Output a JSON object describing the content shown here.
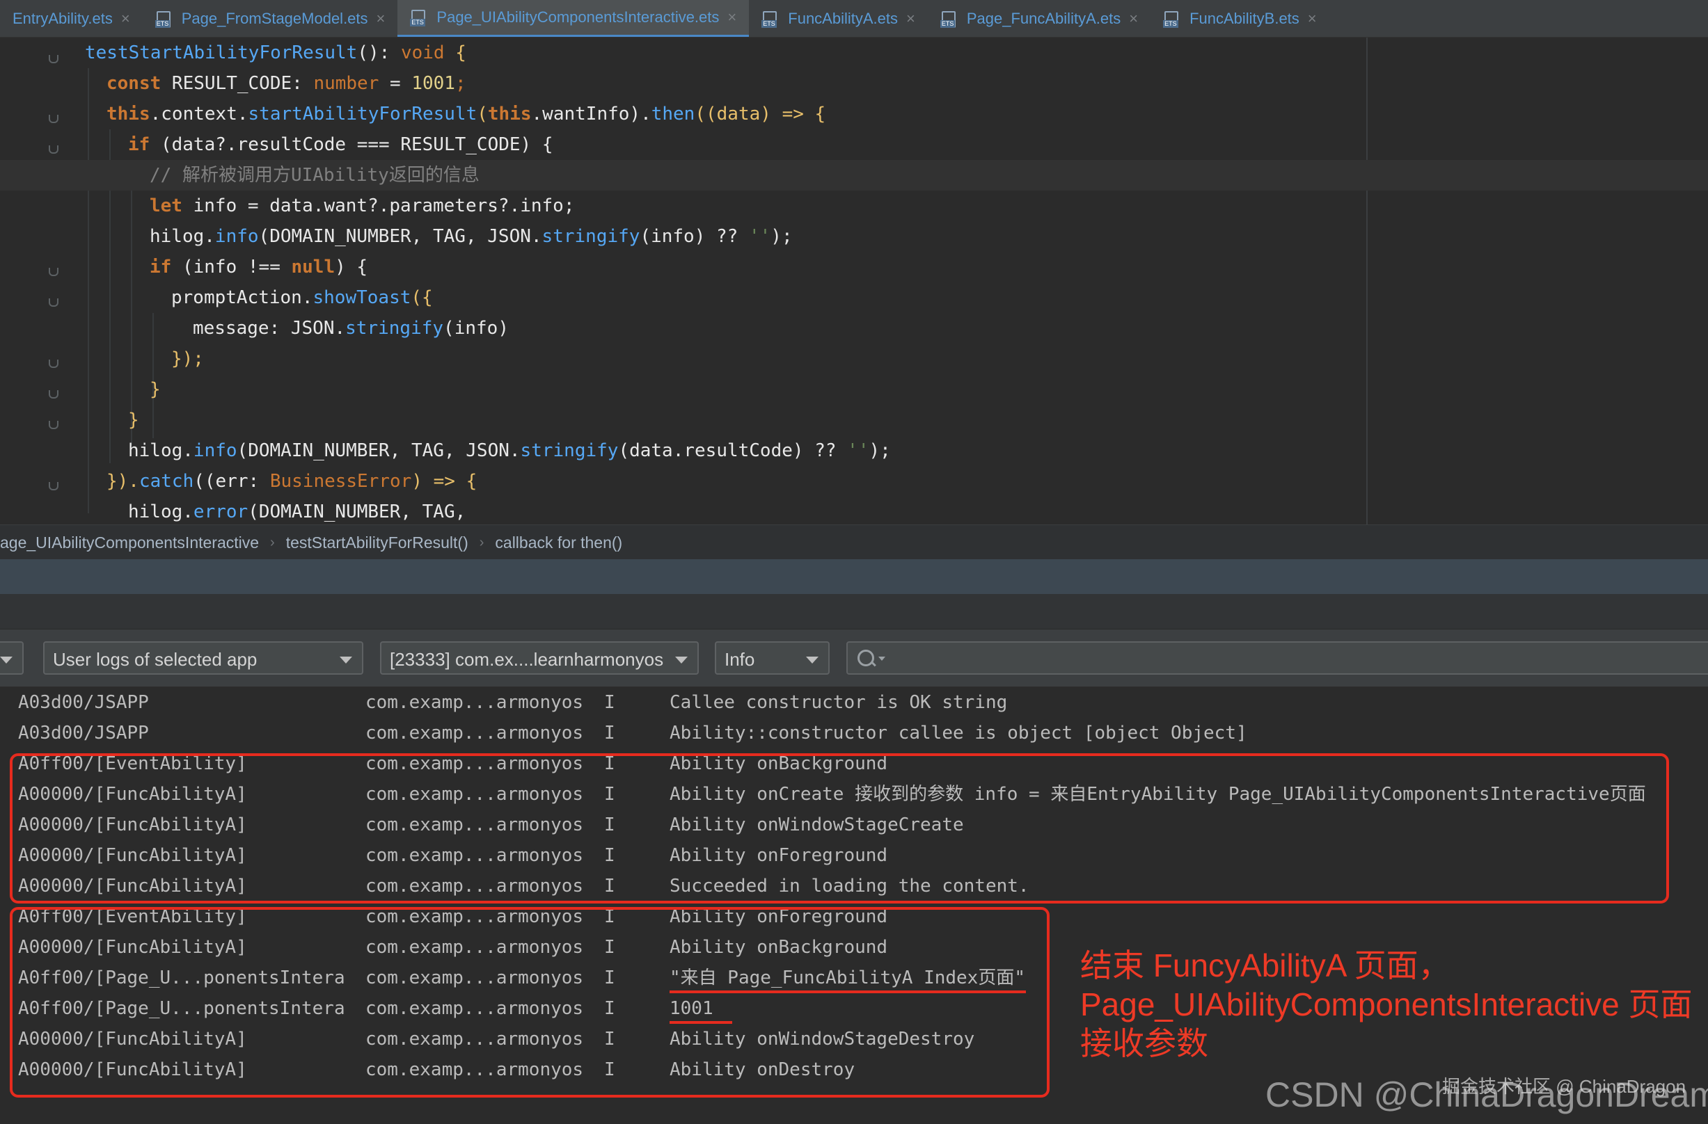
{
  "tabs": [
    {
      "label": "EntryAbility.ets",
      "active": false
    },
    {
      "label": "Page_FromStageModel.ets",
      "active": false
    },
    {
      "label": "Page_UIAbilityComponentsInteractive.ets",
      "active": true
    },
    {
      "label": "FuncAbilityA.ets",
      "active": false
    },
    {
      "label": "Page_FuncAbilityA.ets",
      "active": false
    },
    {
      "label": "FuncAbilityB.ets",
      "active": false
    }
  ],
  "tab_file_badge": "ETS",
  "tab_close_glyph": "×",
  "code": {
    "l1": {
      "fn": "testStartAbilityForResult",
      "p": "(): ",
      "kw": "void",
      "b": " {"
    },
    "l2": {
      "kw": "const",
      "name": " RESULT_CODE: ",
      "type": "number",
      "eq": " = ",
      "num": "1001",
      "end": ";"
    },
    "l3": {
      "kw": "this",
      "a": ".context.",
      "fn": "startAbilityForResult",
      "b": "(",
      "kw2": "this",
      "c": ".wantInfo).",
      "fn2": "then",
      "d": "((data) => {"
    },
    "l4": {
      "kw": "if",
      "a": " (data?.resultCode === RESULT_CODE) {"
    },
    "l5": {
      "comment": "// 解析被调用方UIAbility返回的信息"
    },
    "l6": {
      "kw": "let",
      "a": " info = data.want?.parameters?.info;"
    },
    "l7": {
      "a": "hilog.",
      "fn": "info",
      "b": "(DOMAIN_NUMBER, TAG, JSON.",
      "fn2": "stringify",
      "c": "(info) ?? ",
      "str": "''",
      "d": ");"
    },
    "l8": {
      "kw": "if",
      "a": " (info !== ",
      "kw2": "null",
      "b": ") {"
    },
    "l9": {
      "a": "promptAction.",
      "fn": "showToast",
      "b": "({"
    },
    "l10": {
      "a": "message: JSON.",
      "fn": "stringify",
      "b": "(info)"
    },
    "l11": {
      "a": "});"
    },
    "l12": {
      "a": "}"
    },
    "l13": {
      "a": "}"
    },
    "l14": {
      "a": "hilog.",
      "fn": "info",
      "b": "(DOMAIN_NUMBER, TAG, JSON.",
      "fn2": "stringify",
      "c": "(data.resultCode) ?? ",
      "str": "''",
      "d": ");"
    },
    "l15": {
      "a": "}).",
      "fn": "catch",
      "b": "((err: ",
      "type": "BusinessError",
      "c": ") => {"
    },
    "l16": {
      "a": "hilog.",
      "fn": "error",
      "b": "(DOMAIN_NUMBER, TAG,"
    }
  },
  "breadcrumb": [
    "age_UIAbilityComponentsInteractive",
    "testStartAbilityForResult()",
    "callback for then()"
  ],
  "breadcrumb_sep": "›",
  "log_toolbar": {
    "filter": "User logs of selected app",
    "process": "[23333] com.ex....learnharmonyos",
    "level": "Info",
    "search_placeholder": ""
  },
  "logs": [
    {
      "tag": "A03d00/JSAPP",
      "pkg": "com.examp...armonyos",
      "lvl": "I",
      "msg": "Callee constructor is OK string"
    },
    {
      "tag": "A03d00/JSAPP",
      "pkg": "com.examp...armonyos",
      "lvl": "I",
      "msg": "Ability::constructor callee is object [object Object]"
    },
    {
      "tag": "A0ff00/[EventAbility]",
      "pkg": "com.examp...armonyos",
      "lvl": "I",
      "msg": "Ability onBackground"
    },
    {
      "tag": "A00000/[FuncAbilityA]",
      "pkg": "com.examp...armonyos",
      "lvl": "I",
      "msg": "Ability onCreate 接收到的参数 info = 来自EntryAbility Page_UIAbilityComponentsInteractive页面"
    },
    {
      "tag": "A00000/[FuncAbilityA]",
      "pkg": "com.examp...armonyos",
      "lvl": "I",
      "msg": "Ability onWindowStageCreate"
    },
    {
      "tag": "A00000/[FuncAbilityA]",
      "pkg": "com.examp...armonyos",
      "lvl": "I",
      "msg": "Ability onForeground"
    },
    {
      "tag": "A00000/[FuncAbilityA]",
      "pkg": "com.examp...armonyos",
      "lvl": "I",
      "msg": "Succeeded in loading the content."
    },
    {
      "tag": "A0ff00/[EventAbility]",
      "pkg": "com.examp...armonyos",
      "lvl": "I",
      "msg": "Ability onForeground"
    },
    {
      "tag": "A00000/[FuncAbilityA]",
      "pkg": "com.examp...armonyos",
      "lvl": "I",
      "msg": "Ability onBackground"
    },
    {
      "tag": "A0ff00/[Page_U...ponentsIntera",
      "pkg": "com.examp...armonyos",
      "lvl": "I",
      "msg": "\"来自 Page_FuncAbilityA Index页面\""
    },
    {
      "tag": "A0ff00/[Page_U...ponentsIntera",
      "pkg": "com.examp...armonyos",
      "lvl": "I",
      "msg": "1001"
    },
    {
      "tag": "A00000/[FuncAbilityA]",
      "pkg": "com.examp...armonyos",
      "lvl": "I",
      "msg": "Ability onWindowStageDestroy"
    },
    {
      "tag": "A00000/[FuncAbilityA]",
      "pkg": "com.examp...armonyos",
      "lvl": "I",
      "msg": "Ability onDestroy"
    }
  ],
  "annotation": {
    "line1": "结束 FuncyAbilityA 页面，",
    "line2": "Page_UIAbilityComponentsInteractive 页面",
    "line3": "接收参数"
  },
  "watermark": {
    "site": "掘金技术社区 @ ChinaDragon",
    "csdn": "CSDN @ChinaDragonDreamer"
  },
  "colors": {
    "annotation_red": "#e62b1e",
    "function_blue": "#56a8f5",
    "keyword_orange": "#cc7832"
  }
}
